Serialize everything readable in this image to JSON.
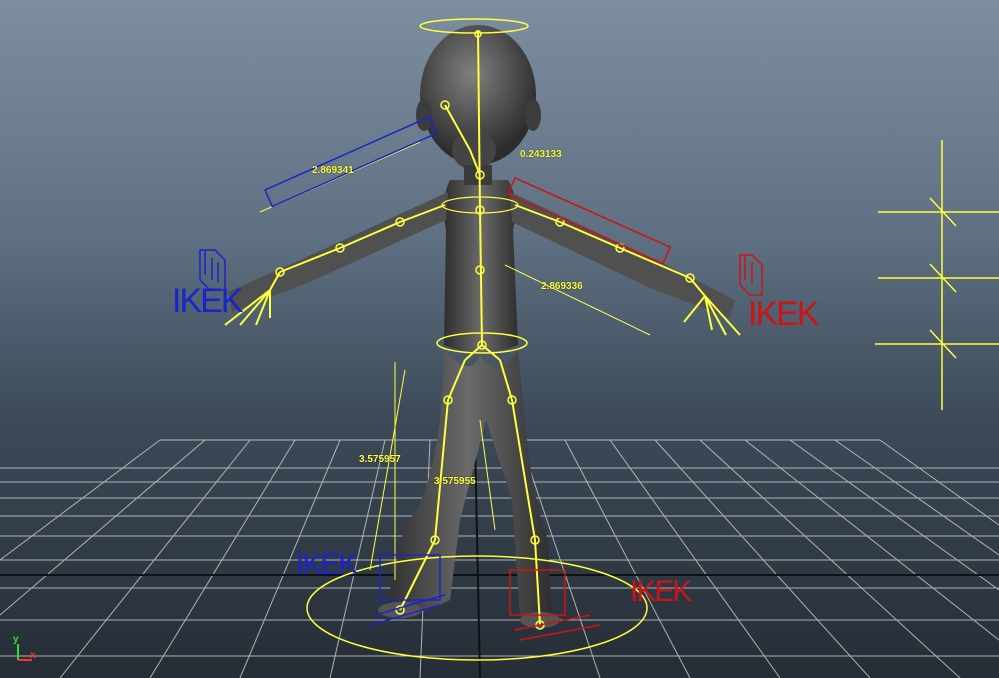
{
  "viewport": {
    "measurements": {
      "left_arm": "2.869341",
      "neck": "0.243133",
      "right_arm": "2.869336",
      "left_leg": "3.575957",
      "right_leg": "3.575955"
    },
    "ik_labels": {
      "left_hand": "IKEK",
      "right_hand": "IKEK",
      "left_foot": "IKEK",
      "right_foot": "IKEK"
    },
    "axis": {
      "y": "y",
      "x": "x"
    },
    "colors": {
      "joint": "#ffff40",
      "left_controls": "#1b24c8",
      "right_controls": "#cc1414",
      "grid": "#c8c8c8",
      "body": "#4a4a4a"
    }
  }
}
